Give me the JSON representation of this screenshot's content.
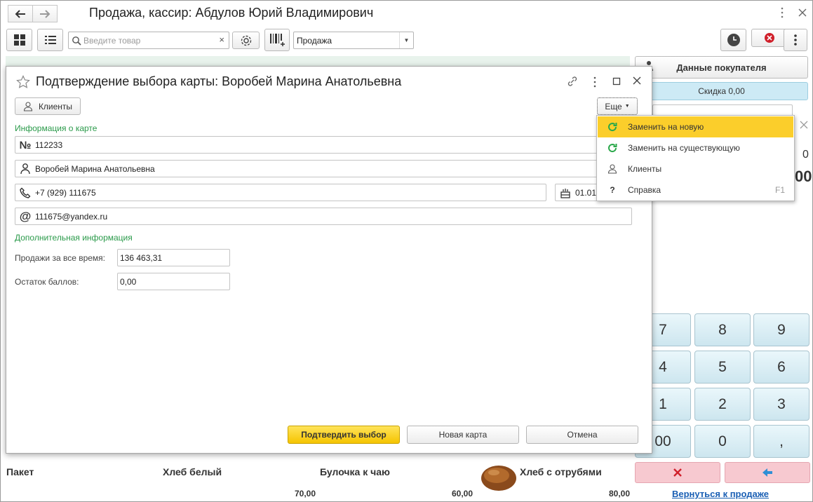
{
  "window": {
    "title": "Продажа, кассир: Абдулов Юрий Владимирович"
  },
  "toolbar": {
    "search_placeholder": "Введите товар",
    "search_clear": "×",
    "operation_value": "Продажа",
    "operation_arrow": "▼"
  },
  "right_panel": {
    "customer_data_label": "Данные покупателя",
    "discount_label": "Скидка 0,00",
    "amount_partial_1": "0",
    "amount_partial_2": "00",
    "keypad": [
      "7",
      "8",
      "9",
      "4",
      "5",
      "6",
      "1",
      "2",
      "3",
      "00",
      "0",
      ","
    ],
    "return_link": "Вернуться к продаже"
  },
  "goods": [
    {
      "name": "Пакет",
      "price": ""
    },
    {
      "name": "Хлеб белый",
      "price": "70,00"
    },
    {
      "name": "Булочка к чаю",
      "price": "60,00"
    },
    {
      "name": "Хлеб с отрубями",
      "price": "80,00"
    }
  ],
  "dialog": {
    "title": "Подтверждение выбора карты: Воробей Марина Анатольевна",
    "clients_button": "Клиенты",
    "more_button": "Еще",
    "card_section": "Информация о карте",
    "card_number": "112233",
    "owner_name": "Воробей Марина Анатольевна",
    "phone": "+7 (929) 111675",
    "birth_date_partial": "01.01",
    "email": "111675@yandex.ru",
    "extra_section": "Дополнительная информация",
    "sales_label": "Продажи за все время:",
    "sales_value": "136 463,31",
    "points_label": "Остаток баллов:",
    "points_value": "0,00",
    "confirm_button": "Подтвердить выбор",
    "new_card_button": "Новая карта",
    "cancel_button": "Отмена"
  },
  "more_menu": {
    "items": [
      {
        "label": "Заменить на новую",
        "icon": "refresh-icon",
        "shortcut": ""
      },
      {
        "label": "Заменить на существующую",
        "icon": "refresh-icon",
        "shortcut": ""
      },
      {
        "label": "Клиенты",
        "icon": "person-icon",
        "shortcut": ""
      },
      {
        "label": "Справка",
        "icon": "question-icon",
        "shortcut": "F1"
      }
    ]
  },
  "colors": {
    "accent_yellow": "#fbce2b",
    "section_green": "#2a9a4a",
    "discount_blue": "#cdeaf5",
    "cancel_pink": "#f7c9d0",
    "link_blue": "#1a5fb4"
  }
}
